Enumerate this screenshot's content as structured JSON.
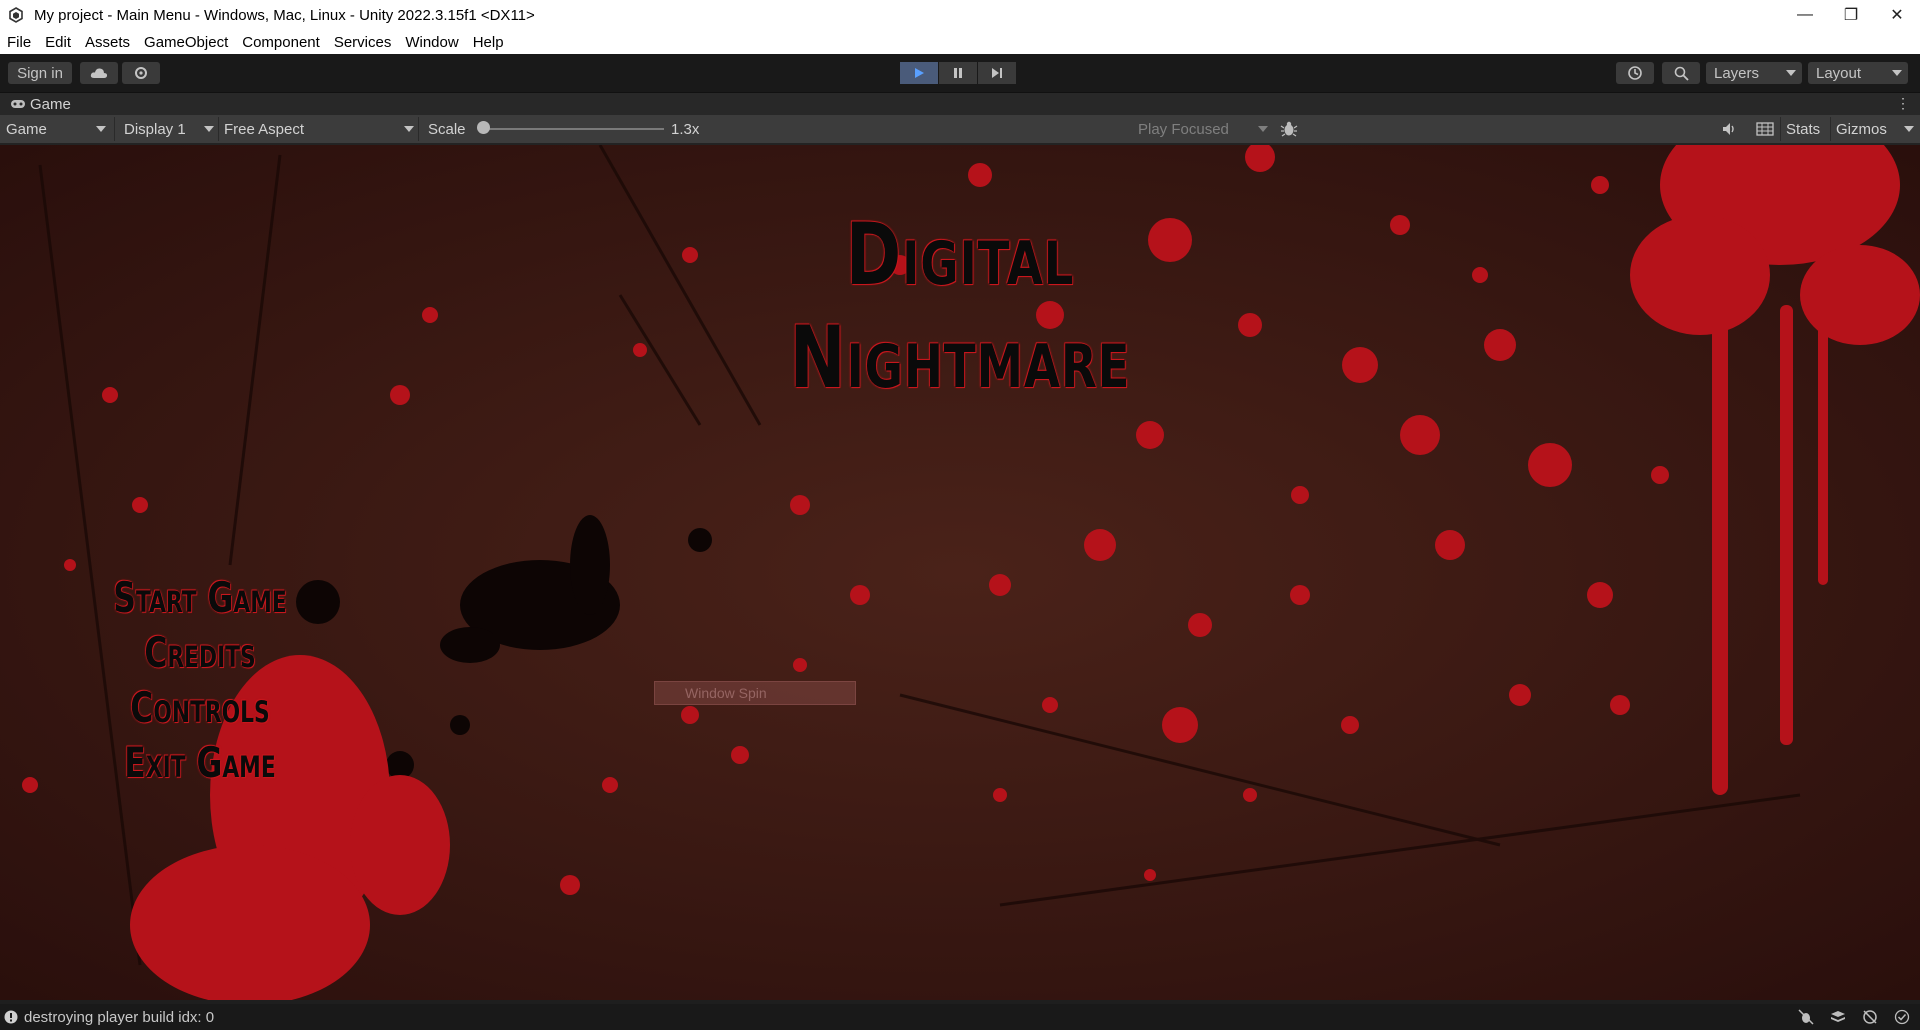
{
  "window": {
    "title": "My project - Main Menu - Windows, Mac, Linux - Unity 2022.3.15f1 <DX11>"
  },
  "menubar": {
    "items": [
      "File",
      "Edit",
      "Assets",
      "GameObject",
      "Component",
      "Services",
      "Window",
      "Help"
    ]
  },
  "toolbar": {
    "sign_in": "Sign in",
    "layers": "Layers",
    "layout": "Layout"
  },
  "game_tab": {
    "label": "Game"
  },
  "game_bar": {
    "view_mode": "Game",
    "display": "Display 1",
    "aspect": "Free Aspect",
    "scale_label": "Scale",
    "scale_value": "1.3x",
    "play_focused": "Play Focused",
    "stats": "Stats",
    "gizmos": "Gizmos"
  },
  "game_view": {
    "title_line1": "Digital",
    "title_line2": "Nightmare",
    "menu": [
      "Start Game",
      "Credits",
      "Controls",
      "Exit Game"
    ],
    "ghost_label": "Window Spin",
    "colors": {
      "background": "#3a1a15",
      "blood": "#c8181e",
      "ink": "#0a0a0a"
    }
  },
  "statusbar": {
    "message": "destroying player build idx: 0"
  }
}
